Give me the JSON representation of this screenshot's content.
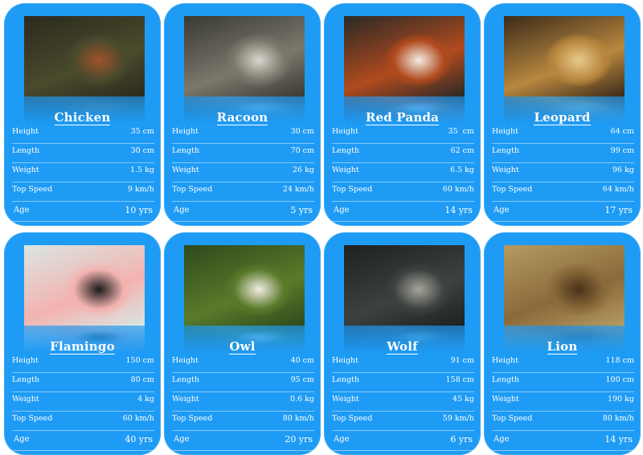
{
  "cards": [
    {
      "name": "Chicken",
      "image": "chicken-photo",
      "palette": [
        "#2b2a1e",
        "#4a4a2c",
        "#a0522d"
      ],
      "stats": [
        {
          "label": "Height",
          "value": "35 cm"
        },
        {
          "label": "Length",
          "value": "30 cm"
        },
        {
          "label": "Weight",
          "value": "1.5 kg"
        },
        {
          "label": "Top Speed",
          "value": "9 km/h"
        },
        {
          "label": "Age",
          "value": "10 yrs"
        }
      ]
    },
    {
      "name": "Racoon",
      "image": "racoon-photo",
      "palette": [
        "#3a3a32",
        "#7a776c",
        "#d8d6cc"
      ],
      "stats": [
        {
          "label": "Height",
          "value": "30 cm"
        },
        {
          "label": "Length",
          "value": "70 cm"
        },
        {
          "label": "Weight",
          "value": "26 kg"
        },
        {
          "label": "Top Speed",
          "value": "24 km/h"
        },
        {
          "label": "Age",
          "value": "5 yrs"
        }
      ]
    },
    {
      "name": "Red Panda",
      "image": "red-panda-photo",
      "palette": [
        "#2a2a26",
        "#b04a1e",
        "#f2ede4"
      ],
      "stats": [
        {
          "label": "Height",
          "value": "35  cm"
        },
        {
          "label": "Length",
          "value": "62 cm"
        },
        {
          "label": "Weight",
          "value": "6.5 kg"
        },
        {
          "label": "Top Speed",
          "value": "60 km/h"
        },
        {
          "label": "Age",
          "value": "14 yrs"
        }
      ]
    },
    {
      "name": "Leopard",
      "image": "leopard-photo",
      "palette": [
        "#3b2a1a",
        "#b8873e",
        "#e8c98a"
      ],
      "stats": [
        {
          "label": "Height",
          "value": "64 cm"
        },
        {
          "label": "Length",
          "value": "99 cm"
        },
        {
          "label": "Weight",
          "value": "96 kg"
        },
        {
          "label": "Top Speed",
          "value": "64 km/h"
        },
        {
          "label": "Age",
          "value": "17 yrs"
        }
      ]
    },
    {
      "name": "Flamingo",
      "image": "flamingo-photo",
      "palette": [
        "#d9e6e2",
        "#f3b3b0",
        "#1a1a1a"
      ],
      "stats": [
        {
          "label": "Height",
          "value": "150 cm"
        },
        {
          "label": "Length",
          "value": "80 cm"
        },
        {
          "label": "Weight",
          "value": "4 kg"
        },
        {
          "label": "Top Speed",
          "value": "60 km/h"
        },
        {
          "label": "Age",
          "value": "40 yrs"
        }
      ]
    },
    {
      "name": "Owl",
      "image": "owl-photo",
      "palette": [
        "#2f4a1c",
        "#5a7a2a",
        "#f1ece2"
      ],
      "stats": [
        {
          "label": "Height",
          "value": "40 cm"
        },
        {
          "label": "Length",
          "value": "95 cm"
        },
        {
          "label": "Weight",
          "value": "0.6 kg"
        },
        {
          "label": "Top Speed",
          "value": "80 km/h"
        },
        {
          "label": "Age",
          "value": "20 yrs"
        }
      ]
    },
    {
      "name": "Wolf",
      "image": "wolf-photo",
      "palette": [
        "#1d2120",
        "#3c4240",
        "#a7a49a"
      ],
      "stats": [
        {
          "label": "Height",
          "value": "91 cm"
        },
        {
          "label": "Length",
          "value": "158 cm"
        },
        {
          "label": "Weight",
          "value": "45 kg"
        },
        {
          "label": "Top Speed",
          "value": "59 km/h"
        },
        {
          "label": "Age",
          "value": "6 yrs"
        }
      ]
    },
    {
      "name": "Lion",
      "image": "lion-photo",
      "palette": [
        "#b59a62",
        "#8a6a3a",
        "#4a3218"
      ],
      "stats": [
        {
          "label": "Height",
          "value": "118 cm"
        },
        {
          "label": "Length",
          "value": "100 cm"
        },
        {
          "label": "Weight",
          "value": "190 kg"
        },
        {
          "label": "Top Speed",
          "value": "80 km/h"
        },
        {
          "label": "Age",
          "value": "14 yrs"
        }
      ]
    }
  ],
  "colors": {
    "card": "#1e9bf5",
    "text": "#ffffff",
    "background": "#ffffff"
  }
}
